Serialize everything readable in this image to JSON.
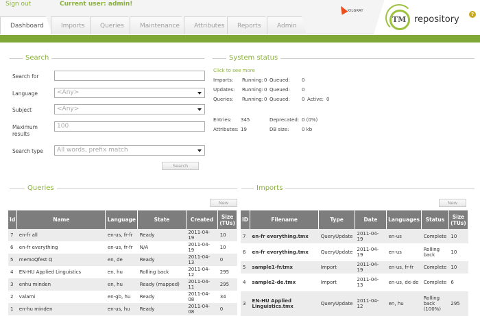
{
  "header": {
    "sign_out": "Sign out",
    "current_user": "Current user: admin!",
    "brand_small": "KILGRAY",
    "logo_tm": "TM",
    "logo_text": "repository",
    "help": "?"
  },
  "tabs": [
    "Dashboard",
    "Imports",
    "Queries",
    "Maintenance",
    "Attributes",
    "Reports",
    "Admin"
  ],
  "search": {
    "title": "Search",
    "search_for_label": "Search for",
    "search_for_value": "",
    "language_label": "Language",
    "language_value": "<Any>",
    "subject_label": "Subject",
    "subject_value": "<Any>",
    "max_label_1": "Maximum",
    "max_label_2": "results",
    "max_value": "100",
    "type_label": "Search type",
    "type_value": "All words, prefix match",
    "button": "Search"
  },
  "status": {
    "title": "System status",
    "link": "Click to see more",
    "rows": [
      {
        "k": "Imports:",
        "r": "Running:",
        "rv": "0",
        "q": "Queued:",
        "qv": "0",
        "a": "",
        "av": ""
      },
      {
        "k": "Updates:",
        "r": "Running:",
        "rv": "0",
        "q": "Queued:",
        "qv": "0",
        "a": "",
        "av": ""
      },
      {
        "k": "Queries:",
        "r": "Running:",
        "rv": "0",
        "q": "Queued:",
        "qv": "0",
        "a": "Active:",
        "av": "0"
      }
    ],
    "entries_label": "Entries:",
    "entries": "345",
    "deprecated_label": "Deprecated:",
    "deprecated": "0 (0%)",
    "attributes_label": "Attributes:",
    "attributes": "19",
    "dbsize_label": "DB size:",
    "dbsize": "0 kb"
  },
  "queries": {
    "title": "Queries",
    "new_button": "New",
    "columns": [
      "Id",
      "Name",
      "Language",
      "State",
      "Created",
      "Size (TUs)"
    ],
    "rows": [
      [
        "7",
        "en-fr all",
        "en-us, fr-fr",
        "Ready",
        "2011-04-19",
        "10"
      ],
      [
        "6",
        "en-fr everything",
        "en-us, fr-fr",
        "N/A",
        "2011-04-19",
        "10"
      ],
      [
        "5",
        "memoQfest Q",
        "en, de",
        "Ready",
        "2011-04-13",
        "0"
      ],
      [
        "4",
        "EN-HU Applied Linguistics",
        "en, hu",
        "Rolling back",
        "2011-04-12",
        "295"
      ],
      [
        "3",
        "enhu minden",
        "en, hu",
        "Ready (mapped)",
        "2011-04-11",
        "295"
      ],
      [
        "2",
        "valami",
        "en-gb, hu",
        "Ready",
        "2011-04-08",
        "34"
      ],
      [
        "1",
        "en-hu minden",
        "en-us, hu",
        "Ready",
        "2011-04-08",
        "0"
      ]
    ]
  },
  "imports": {
    "title": "Imports",
    "new_button": "New",
    "columns": [
      "ID",
      "Filename",
      "Type",
      "Date",
      "Languages",
      "Status",
      "Size (TUs)"
    ],
    "rows": [
      [
        "7",
        "en-fr everything.tmx",
        "QueryUpdate",
        "2011-04-19",
        "en-us",
        "Complete",
        "10"
      ],
      [
        "6",
        "en-fr everything.tmx",
        "QueryUpdate",
        "2011-04-19",
        "en-us",
        "Rolling back",
        "10"
      ],
      [
        "5",
        "sample1-fr.tmx",
        "Import",
        "2011-04-19",
        "en-us, fr-fr",
        "Complete",
        "10"
      ],
      [
        "4",
        "sample2-de.tmx",
        "Import",
        "2011-04-13",
        "en-us, de-de",
        "Complete",
        "6"
      ],
      [
        "3",
        "EN-HU Applied Linguistics.tmx",
        "QueryUpdate",
        "2011-04-12",
        "en, hu",
        "Rolling back (100%)",
        "295"
      ]
    ]
  }
}
